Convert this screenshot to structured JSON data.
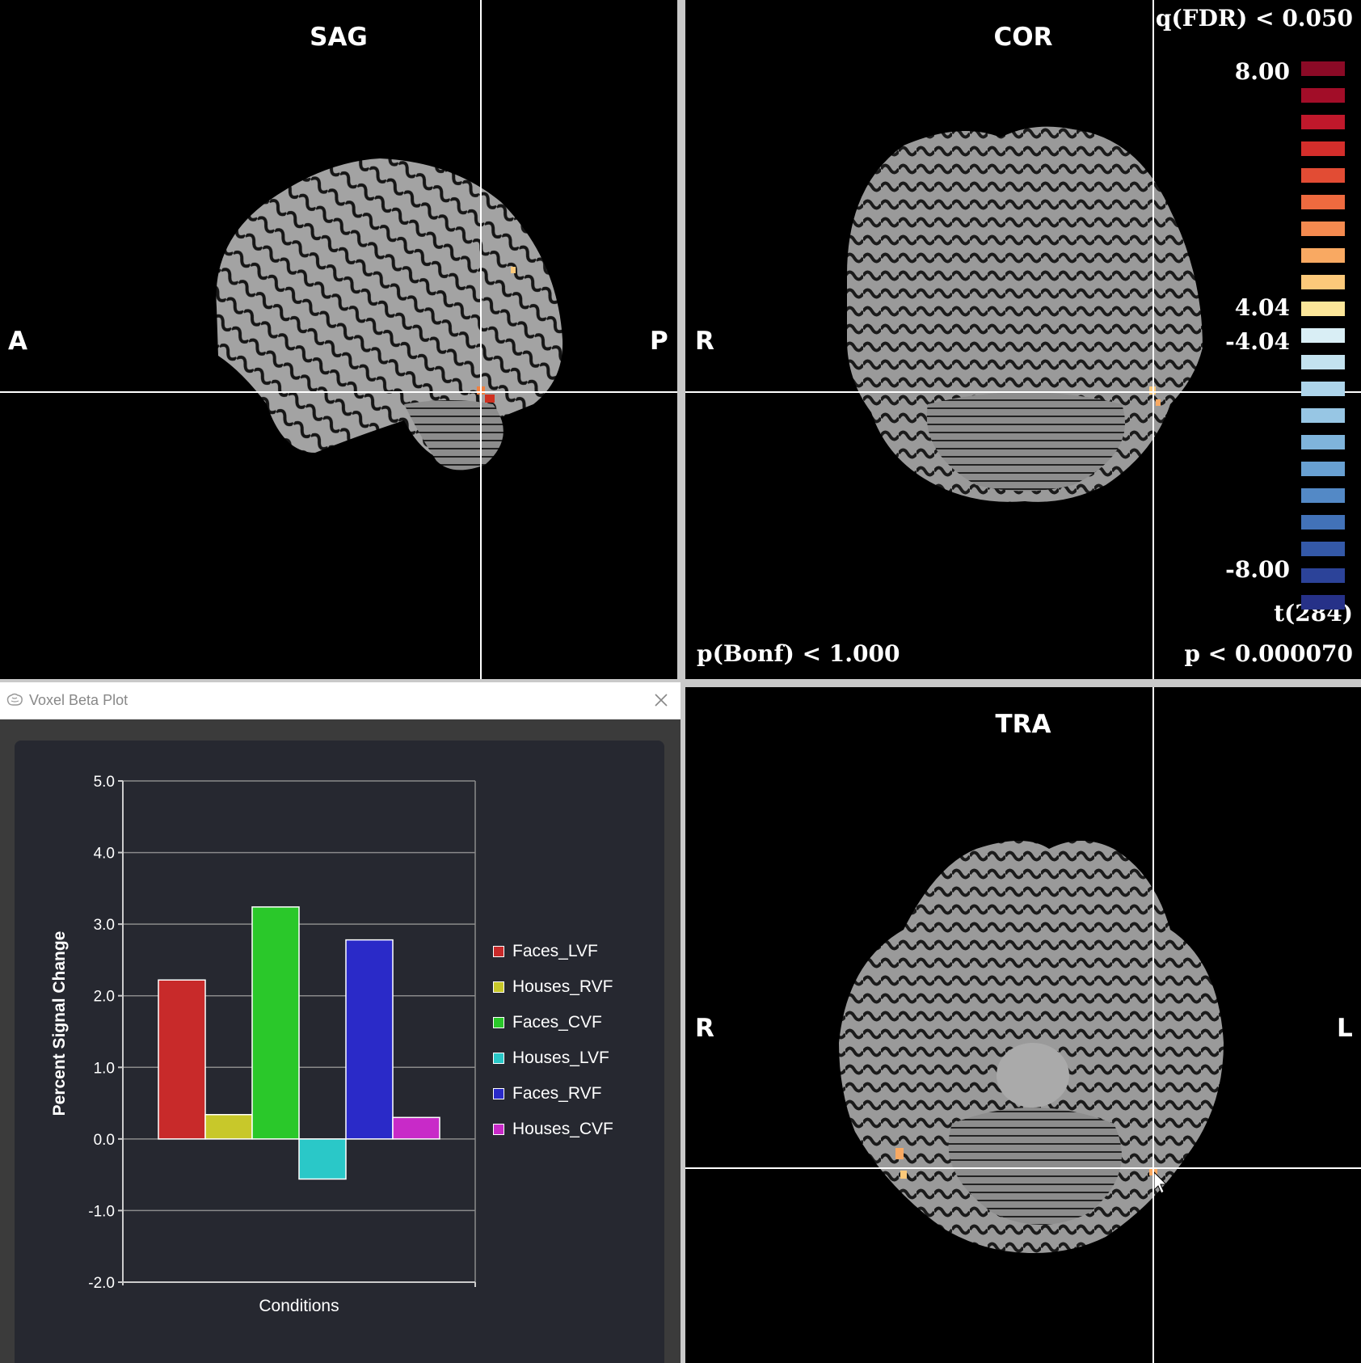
{
  "views": {
    "sagittal": {
      "title": "SAG",
      "left_label": "A",
      "right_label": "P"
    },
    "coronal": {
      "title": "COR",
      "left_label": "R"
    },
    "transverse": {
      "title": "TRA",
      "left_label": "R",
      "right_label": "L"
    }
  },
  "stats": {
    "fdr": "q(FDR) < 0.050",
    "bonf": "p(Bonf) < 1.000",
    "p": "p < 0.000070",
    "df": "t(284)"
  },
  "colorbar": {
    "labels": {
      "max": "8.00",
      "pos_thresh": "4.04",
      "neg_thresh": "-4.04",
      "min": "-8.00"
    },
    "positive_colors": [
      "#8b0a26",
      "#a20d28",
      "#c0182b",
      "#d42e2b",
      "#e24c34",
      "#ee6a3f",
      "#f48a4f",
      "#f9a962",
      "#fcc97a",
      "#fce699"
    ],
    "negative_colors": [
      "#d9eef5",
      "#c3e2ef",
      "#add4ea",
      "#97c6e4",
      "#7fb4db",
      "#68a0d2",
      "#5389c6",
      "#4272b8",
      "#3459a8",
      "#2c4399",
      "#263188"
    ]
  },
  "plot_window": {
    "title": "Voxel Beta Plot",
    "app_icon": "brain-icon",
    "close_icon": "close-icon"
  },
  "chart_data": {
    "type": "bar",
    "categories": [
      "Faces_LVF",
      "Houses_RVF",
      "Faces_CVF",
      "Houses_LVF",
      "Faces_RVF",
      "Houses_CVF"
    ],
    "values": [
      2.22,
      0.34,
      3.24,
      -0.56,
      2.78,
      0.3
    ],
    "colors": [
      "#c82a2a",
      "#c8c82a",
      "#2ac82a",
      "#2ac8c8",
      "#2a2ac8",
      "#c82ac8"
    ],
    "xlabel": "Conditions",
    "ylabel": "Percent Signal Change",
    "ylim": [
      -2.0,
      5.0
    ],
    "yticks": [
      "5.0",
      "4.0",
      "3.0",
      "2.0",
      "1.0",
      "0.0",
      "-1.0",
      "-2.0"
    ],
    "grid": true,
    "legend_position": "right"
  }
}
